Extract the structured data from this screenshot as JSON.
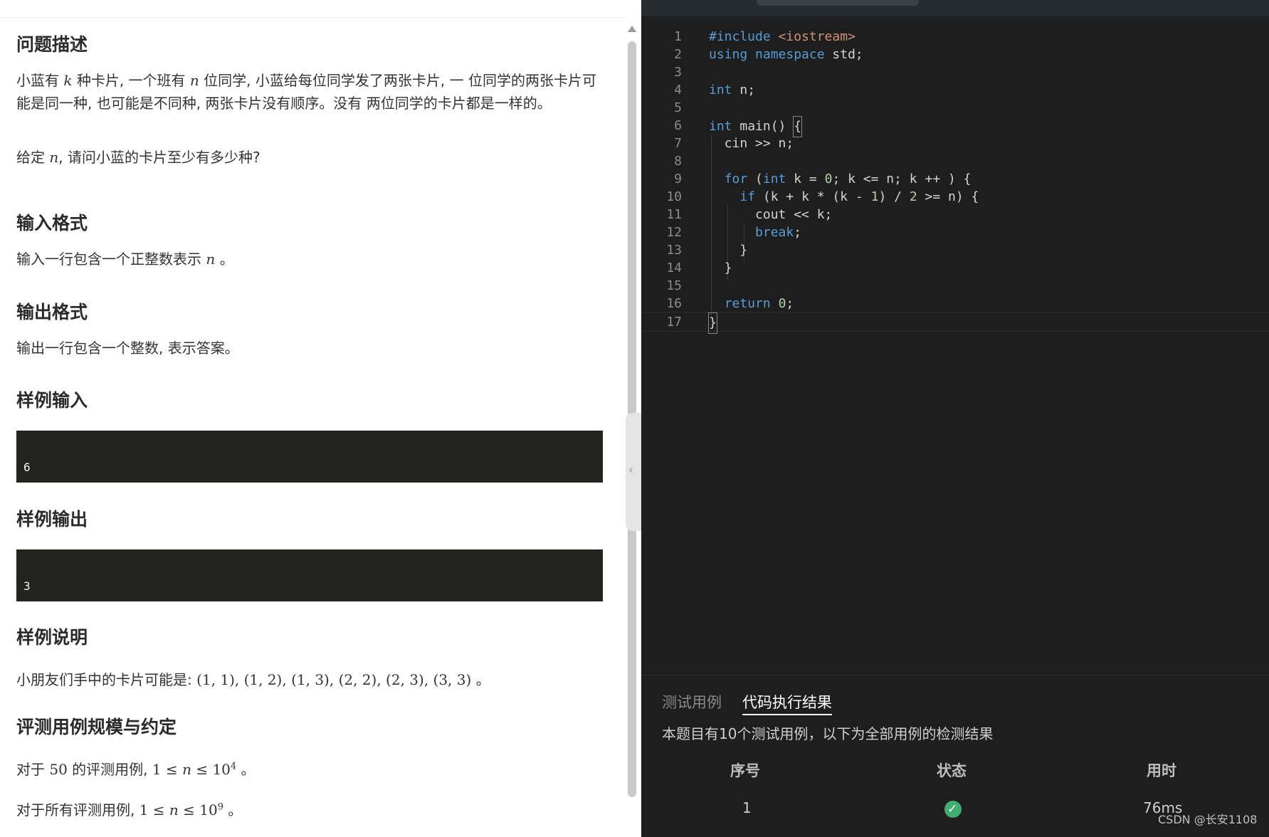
{
  "problem": {
    "section_description_title": "问题描述",
    "desc_p1_a": "小蓝有 ",
    "desc_p1_var_k": "k",
    "desc_p1_b": " 种卡片, 一个班有 ",
    "desc_p1_var_n": "n",
    "desc_p1_c": " 位同学, 小蓝给每位同学发了两张卡片, 一 位同学的两张卡片可能是同一种, 也可能是不同种, 两张卡片没有顺序。没有 两位同学的卡片都是一样的。",
    "desc_p2_a": "给定 ",
    "desc_p2_var_n": "n",
    "desc_p2_b": ", 请问小蓝的卡片至少有多少种?",
    "section_input_title": "输入格式",
    "input_a": "输入一行包含一个正整数表示 ",
    "input_var_n": "n",
    "input_b": " 。",
    "section_output_title": "输出格式",
    "output_text": "输出一行包含一个整数, 表示答案。",
    "section_sample_input_title": "样例输入",
    "sample_input": "6",
    "section_sample_output_title": "样例输出",
    "sample_output": "3",
    "section_sample_explain_title": "样例说明",
    "explain_a": "小朋友们手中的卡片可能是: ",
    "explain_math": "(1, 1), (1, 2), (1, 3), (2, 2), (2, 3), (3, 3)",
    "explain_b": " 。",
    "section_scale_title": "评测用例规模与约定",
    "scale1_a": "对于 ",
    "scale1_pct": "50",
    "scale1_b": " 的评测用例, ",
    "scale1_math_a": "1 ≤ ",
    "scale1_math_n": "n",
    "scale1_math_b": " ≤ 10",
    "scale1_exp": "4",
    "scale1_c": " 。",
    "scale2_a": "对于所有评测用例, ",
    "scale2_math_a": "1 ≤ ",
    "scale2_math_n": "n",
    "scale2_math_b": " ≤ 10",
    "scale2_exp": "9",
    "scale2_c": " 。"
  },
  "editor": {
    "lines": [
      {
        "n": "1"
      },
      {
        "n": "2"
      },
      {
        "n": "3"
      },
      {
        "n": "4"
      },
      {
        "n": "5"
      },
      {
        "n": "6"
      },
      {
        "n": "7"
      },
      {
        "n": "8"
      },
      {
        "n": "9"
      },
      {
        "n": "10"
      },
      {
        "n": "11"
      },
      {
        "n": "12"
      },
      {
        "n": "13"
      },
      {
        "n": "14"
      },
      {
        "n": "15"
      },
      {
        "n": "16"
      },
      {
        "n": "17"
      }
    ],
    "code": {
      "l1_pp": "#include",
      "l1_inc": " <iostream>",
      "l2_kw1": "using",
      "l2_kw2": " namespace",
      "l2_rest": " std;",
      "l4_kw": "int",
      "l4_rest": " n;",
      "l6_kw": "int",
      "l6_rest": " main() ",
      "l6_brace": "{",
      "l7": "  cin >> n;",
      "l9_ind": "  ",
      "l9_for": "for",
      "l9_a": " (",
      "l9_int": "int",
      "l9_b": " k = ",
      "l9_zero": "0",
      "l9_c": "; k <= n; k ++ ) {",
      "l10_ind": "    ",
      "l10_if": "if",
      "l10_a": " (k + k * (k - ",
      "l10_one": "1",
      "l10_b": ") / ",
      "l10_two": "2",
      "l10_c": " >= n) {",
      "l11": "      cout << k;",
      "l12_ind": "      ",
      "l12_break": "break",
      "l12_rest": ";",
      "l13": "    }",
      "l14": "  }",
      "l16_ind": "  ",
      "l16_ret": "return",
      "l16_sp": " ",
      "l16_zero": "0",
      "l16_rest": ";",
      "l17": "}"
    }
  },
  "results": {
    "tab_testcases": "测试用例",
    "tab_result": "代码执行结果",
    "summary": "本题目有10个测试用例，以下为全部用例的检测结果",
    "col_index": "序号",
    "col_status": "状态",
    "col_time": "用时",
    "row1_index": "1",
    "row1_status_icon": "check-circle-icon",
    "row1_time": "76ms"
  },
  "watermark": "CSDN @长安1108",
  "colors": {
    "editor_bg": "#1e1e1e",
    "keyword": "#569cd6",
    "string_include": "#ce9178",
    "number": "#b5cea8",
    "sample_box_bg": "#23241f",
    "status_ok": "#3fae6f"
  }
}
